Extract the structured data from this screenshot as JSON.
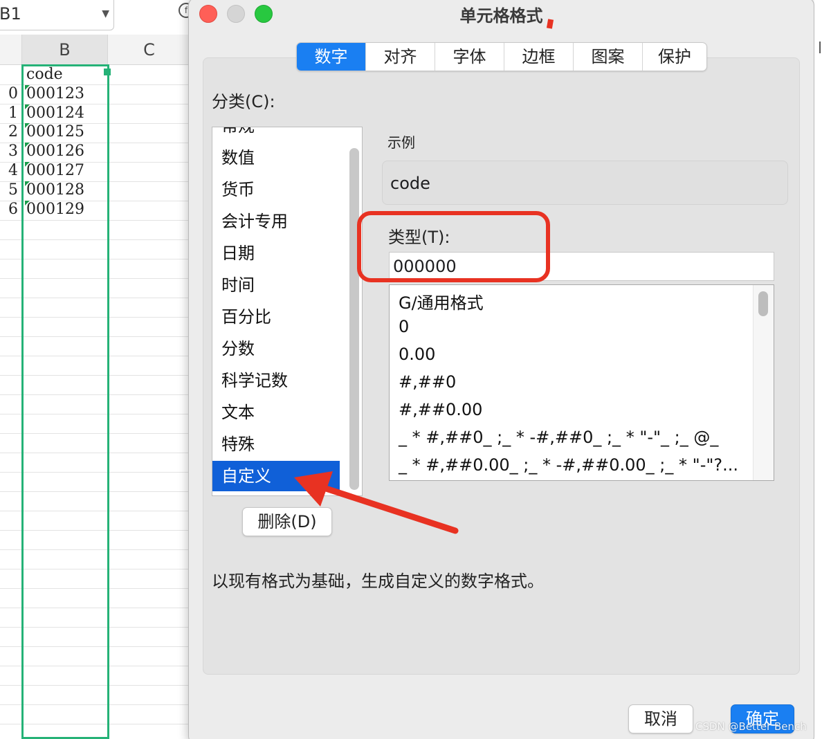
{
  "spreadsheet": {
    "name_box": "B1",
    "columns": [
      "B",
      "C"
    ],
    "rows": [
      {
        "label": "",
        "value": "code"
      },
      {
        "label": "0",
        "value": "000123"
      },
      {
        "label": "1",
        "value": "000124"
      },
      {
        "label": "2",
        "value": "000125"
      },
      {
        "label": "3",
        "value": "000126"
      },
      {
        "label": "4",
        "value": "000127"
      },
      {
        "label": "5",
        "value": "000128"
      },
      {
        "label": "6",
        "value": "000129"
      }
    ]
  },
  "dialog": {
    "title": "单元格格式",
    "tabs": [
      "数字",
      "对齐",
      "字体",
      "边框",
      "图案",
      "保护"
    ],
    "active_tab": "数字",
    "category_label": "分类(C):",
    "categories": [
      "常规",
      "数值",
      "货币",
      "会计专用",
      "日期",
      "时间",
      "百分比",
      "分数",
      "科学记数",
      "文本",
      "特殊",
      "自定义"
    ],
    "selected_category": "自定义",
    "sample_label": "示例",
    "sample_value": "code",
    "type_label": "类型(T):",
    "type_value": "000000",
    "formats": [
      "G/通用格式",
      "0",
      "0.00",
      "#,##0",
      "#,##0.00",
      "_ * #,##0_ ;_ * -#,##0_ ;_ * \"-\"_ ;_ @_",
      "_ * #,##0.00_ ;_ * -#,##0.00_ ;_ * \"-\"?..."
    ],
    "delete_button": "删除(D)",
    "description": "以现有格式为基础，生成自定义的数字格式。",
    "cancel_button": "取消",
    "ok_button": "确定"
  },
  "watermark": "CSDN @Better Bench",
  "colors": {
    "accent": "#1a7ff2",
    "selection": "#1060d8",
    "annotation": "#e83222",
    "cell_selection": "#25b277"
  }
}
